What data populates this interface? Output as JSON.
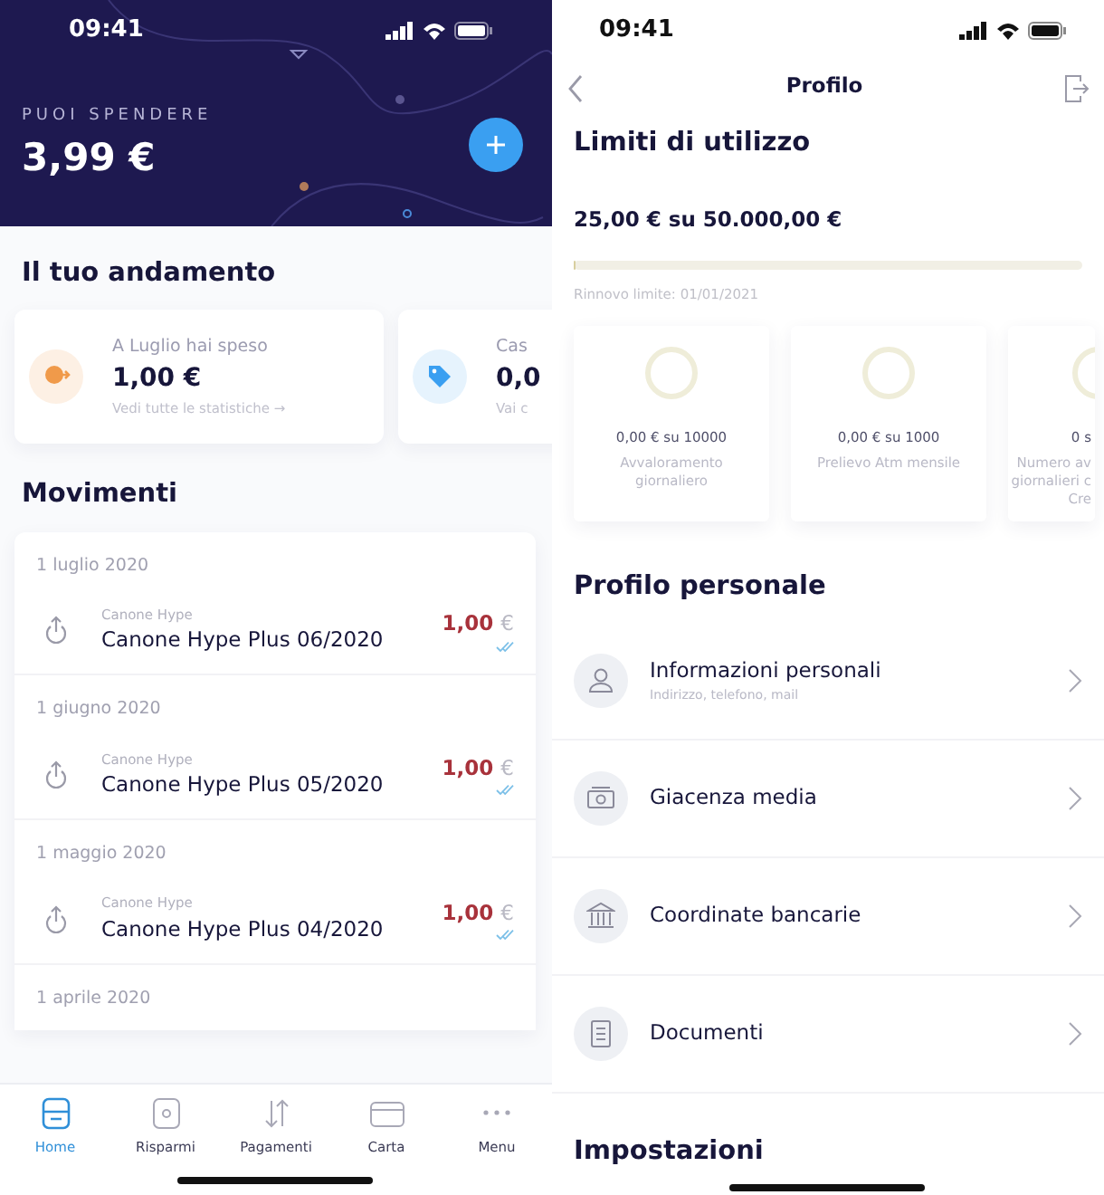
{
  "left": {
    "status_time": "09:41",
    "balance_label": "PUOI SPENDERE",
    "balance": "3,99 €",
    "trend_title": "Il tuo andamento",
    "trend_cards": [
      {
        "kind": "spent",
        "title": "A Luglio hai speso",
        "value": "1,00 €",
        "link": "Vedi tutte le statistiche →"
      },
      {
        "kind": "tag",
        "title": "Cas",
        "value": "0,0",
        "link": "Vai c"
      }
    ],
    "movements_title": "Movimenti",
    "movement_groups": [
      {
        "date": "1 luglio 2020",
        "items": [
          {
            "category": "Canone Hype",
            "title": "Canone Hype Plus 06/2020",
            "amount": "1,00",
            "currency": "€"
          }
        ]
      },
      {
        "date": "1 giugno 2020",
        "items": [
          {
            "category": "Canone Hype",
            "title": "Canone Hype Plus 05/2020",
            "amount": "1,00",
            "currency": "€"
          }
        ]
      },
      {
        "date": "1 maggio 2020",
        "items": [
          {
            "category": "Canone Hype",
            "title": "Canone Hype Plus 04/2020",
            "amount": "1,00",
            "currency": "€"
          }
        ]
      },
      {
        "date": "1 aprile 2020"
      }
    ],
    "tabs": [
      {
        "kind": "home",
        "label": "Home",
        "selected": true
      },
      {
        "kind": "savings",
        "label": "Risparmi",
        "selected": false
      },
      {
        "kind": "payments",
        "label": "Pagamenti",
        "selected": false
      },
      {
        "kind": "card",
        "label": "Carta",
        "selected": false
      },
      {
        "kind": "menu",
        "label": "Menu",
        "selected": false
      }
    ]
  },
  "right": {
    "status_time": "09:41",
    "title": "Profilo",
    "limits_title": "Limiti di utilizzo",
    "limit": {
      "amount": "25,00 € su 50.000,00 €",
      "level": 0.0005
    },
    "renewal": "Rinnovo limite: 01/01/2021",
    "limit_cards": [
      {
        "amount": "0,00 € su 10000",
        "label": "Avvaloramento giornaliero"
      },
      {
        "amount": "0,00 € su 1000",
        "label": "Prelievo Atm mensile"
      },
      {
        "amount": "0 s",
        "label": "Numero av giornalieri c Cre"
      }
    ],
    "personal_title": "Profilo personale",
    "personal_items": [
      {
        "kind": "person",
        "title": "Informazioni personali",
        "subtitle": "Indirizzo, telefono, mail"
      },
      {
        "kind": "money",
        "title": "Giacenza media"
      },
      {
        "kind": "bank",
        "title": "Coordinate bancarie"
      },
      {
        "kind": "document",
        "title": "Documenti"
      }
    ],
    "settings_title": "Impostazioni"
  }
}
